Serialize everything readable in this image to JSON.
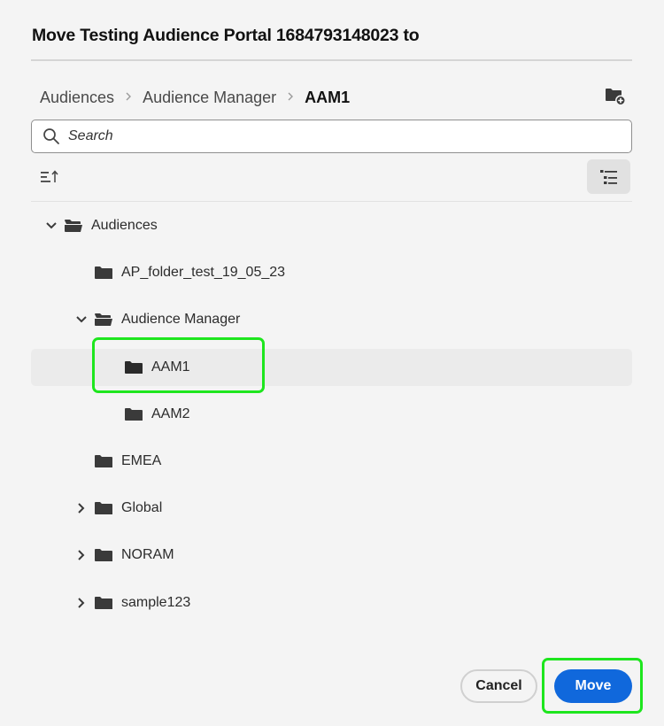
{
  "dialog": {
    "title": "Move Testing Audience Portal 1684793148023 to"
  },
  "breadcrumb": {
    "items": [
      "Audiences",
      "Audience Manager",
      "AAM1"
    ],
    "separator": ">"
  },
  "toolbar": {
    "new_folder_icon": "folder-add-icon",
    "sort_icon": "sort-ascending-icon",
    "view_icon": "tree-view-icon"
  },
  "search": {
    "placeholder": "Search",
    "value": ""
  },
  "tree": {
    "items": [
      {
        "label": "Audiences",
        "level": 0,
        "expandable": true,
        "expanded": true,
        "selected": false
      },
      {
        "label": "AP_folder_test_19_05_23",
        "level": 1,
        "expandable": false,
        "expanded": false,
        "selected": false
      },
      {
        "label": "Audience Manager",
        "level": 1,
        "expandable": true,
        "expanded": true,
        "selected": false
      },
      {
        "label": "AAM1",
        "level": 2,
        "expandable": false,
        "expanded": false,
        "selected": true
      },
      {
        "label": "AAM2",
        "level": 2,
        "expandable": false,
        "expanded": false,
        "selected": false
      },
      {
        "label": "EMEA",
        "level": 1,
        "expandable": false,
        "expanded": false,
        "selected": false
      },
      {
        "label": "Global",
        "level": 1,
        "expandable": true,
        "expanded": false,
        "selected": false
      },
      {
        "label": "NORAM",
        "level": 1,
        "expandable": true,
        "expanded": false,
        "selected": false
      },
      {
        "label": "sample123",
        "level": 1,
        "expandable": true,
        "expanded": false,
        "selected": false
      }
    ]
  },
  "footer": {
    "cancel_label": "Cancel",
    "move_label": "Move"
  },
  "colors": {
    "primary": "#1068dc",
    "highlight": "#1ee61e",
    "background": "#f4f4f4",
    "selected_row": "#ebebeb"
  }
}
